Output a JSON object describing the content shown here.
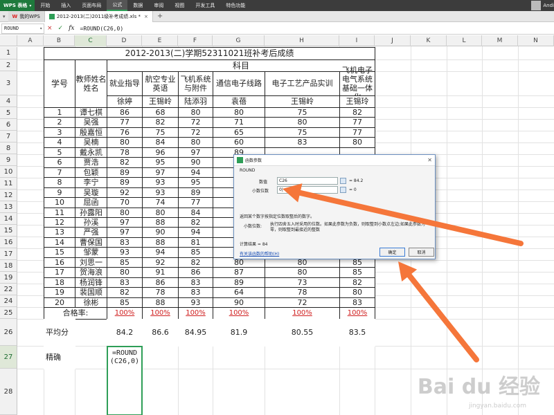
{
  "app": {
    "logo": "WPS 表格"
  },
  "menu": [
    "开始",
    "插入",
    "页面布局",
    "公式",
    "数据",
    "审阅",
    "视图",
    "开发工具",
    "特色功能"
  ],
  "active_menu": "公式",
  "user": {
    "name": "Andi"
  },
  "tabs": [
    {
      "label": "我的WPS"
    },
    {
      "label": "2012-2013(二)2011级补考成绩.xls *"
    }
  ],
  "formula_bar": {
    "name_box": "ROUND",
    "cancel": "×",
    "confirm": "✓",
    "fx": "fx",
    "formula": "=ROUND(C26,0)"
  },
  "columns": [
    "A",
    "B",
    "C",
    "D",
    "E",
    "F",
    "G",
    "H",
    "I",
    "J",
    "K",
    "L",
    "M",
    "N"
  ],
  "rows": [
    "1",
    "2",
    "3",
    "4",
    "5",
    "6",
    "7",
    "8",
    "9",
    "10",
    "11",
    "12",
    "13",
    "14",
    "15",
    "16",
    "17",
    "18",
    "19",
    "22",
    "24",
    "25",
    "26",
    "27",
    "28"
  ],
  "sheet": {
    "title": "2012-2013(二)学期52311021班补考后成绩",
    "subject_header": "科目",
    "student_no_header": "学号",
    "teacher_header": "教师姓名\n姓名",
    "subjects": [
      "就业指导",
      "航空专业英语",
      "飞机系统与附件",
      "通信电子线路",
      "电子工艺产品实训",
      "飞机电子电气系统基础一体化"
    ],
    "teachers": [
      "徐婷",
      "王锡岭",
      "陆添羽",
      "袁蓓",
      "王锡岭",
      "王锡玲"
    ],
    "students": [
      {
        "no": "1",
        "name": "谭七棋",
        "scores": [
          "86",
          "68",
          "80",
          "80",
          "75",
          "82"
        ]
      },
      {
        "no": "2",
        "name": "吴强",
        "scores": [
          "77",
          "82",
          "72",
          "71",
          "80",
          "77"
        ]
      },
      {
        "no": "3",
        "name": "殷嘉恒",
        "scores": [
          "76",
          "75",
          "72",
          "65",
          "75",
          "77"
        ]
      },
      {
        "no": "4",
        "name": "吴楠",
        "scores": [
          "80",
          "84",
          "80",
          "60",
          "83",
          "80"
        ]
      },
      {
        "no": "5",
        "name": "戴永凯",
        "scores": [
          "78",
          "96",
          "97",
          "89",
          "",
          ""
        ]
      },
      {
        "no": "6",
        "name": "贾浩",
        "scores": [
          "82",
          "95",
          "90",
          "90",
          "",
          ""
        ]
      },
      {
        "no": "7",
        "name": "包颖",
        "scores": [
          "89",
          "97",
          "94",
          "96",
          "",
          ""
        ]
      },
      {
        "no": "8",
        "name": "李宁",
        "scores": [
          "89",
          "93",
          "95",
          "92",
          "",
          ""
        ]
      },
      {
        "no": "9",
        "name": "吴璇",
        "scores": [
          "92",
          "93",
          "89",
          "90",
          "",
          ""
        ]
      },
      {
        "no": "10",
        "name": "屈函",
        "scores": [
          "70",
          "74",
          "77",
          "76",
          "",
          ""
        ]
      },
      {
        "no": "11",
        "name": "孙露阳",
        "scores": [
          "80",
          "80",
          "84",
          "73",
          "",
          ""
        ]
      },
      {
        "no": "12",
        "name": "孙溪",
        "scores": [
          "97",
          "88",
          "82",
          "96",
          "",
          ""
        ]
      },
      {
        "no": "13",
        "name": "严强",
        "scores": [
          "97",
          "90",
          "94",
          "93",
          "",
          ""
        ]
      },
      {
        "no": "14",
        "name": "曹保国",
        "scores": [
          "83",
          "88",
          "81",
          "79",
          "85",
          "83"
        ]
      },
      {
        "no": "15",
        "name": "邹蒙",
        "scores": [
          "93",
          "94",
          "85",
          "88",
          "80",
          "85"
        ]
      },
      {
        "no": "16",
        "name": "刘思一",
        "scores": [
          "85",
          "92",
          "82",
          "80",
          "80",
          "85"
        ]
      },
      {
        "no": "17",
        "name": "贺海浪",
        "scores": [
          "80",
          "91",
          "86",
          "87",
          "80",
          "85"
        ]
      },
      {
        "no": "18",
        "name": "杨润锋",
        "scores": [
          "83",
          "86",
          "83",
          "89",
          "73",
          "82"
        ]
      },
      {
        "no": "19",
        "name": "裴国顺",
        "scores": [
          "82",
          "78",
          "83",
          "64",
          "78",
          "80"
        ]
      },
      {
        "no": "20",
        "name": "徐彬",
        "scores": [
          "85",
          "88",
          "93",
          "90",
          "72",
          "83"
        ]
      }
    ],
    "pass_rate_label": "合格率:",
    "pass_rates": [
      "100%",
      "100%",
      "100%",
      "100%",
      "100%",
      "100%"
    ],
    "average_label": "平均分",
    "averages": [
      "84.2",
      "86.6",
      "84.95",
      "81.9",
      "80.55",
      "83.5"
    ],
    "precise_label": "精确",
    "precise_formula": "=ROUND(C26,0)"
  },
  "dialog": {
    "title": "函数参数",
    "function_name": "ROUND",
    "arg1_label": "数值",
    "arg1_value": "C26",
    "arg1_result": "= 84.2",
    "arg2_label": "小数位数",
    "arg2_value": "0|",
    "arg2_result": "= 0",
    "result_preview": "= 84",
    "description": "返回某个数字按指定位数取整后的数字。",
    "param_desc_label": "小数位数:",
    "param_desc": "执行四舍五入时采用的位数。如果此参数为负数，则取整到小数点左边;如果此参数为零，则取整到最接近的整数",
    "calc_result": "计算结果 = 84",
    "help_link": "有关该函数的帮助(H)",
    "ok": "确定",
    "cancel": "取消"
  },
  "watermark": {
    "main": "Bai du 经验",
    "sub": "jingyan.baidu.com"
  },
  "colors": {
    "arrow": "#f5763a",
    "menubar": "#3c3c3c",
    "logo": "#1e7a3c",
    "pass_rate": "#d02020"
  }
}
